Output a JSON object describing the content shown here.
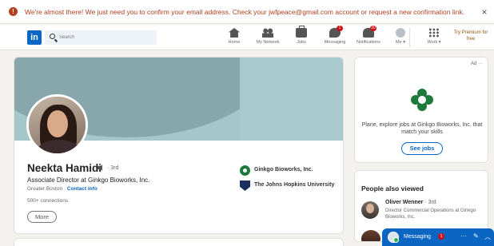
{
  "alert": {
    "message": "We're almost there! We just need you to confirm your email address. Check your jwfpeace@gmail.com account or request a new confirmation link.",
    "close": "×"
  },
  "nav": {
    "logo": "in",
    "search_placeholder": "Search",
    "items": [
      {
        "label": "Home",
        "icon": "home-icon"
      },
      {
        "label": "My Network",
        "icon": "network-icon"
      },
      {
        "label": "Jobs",
        "icon": "jobs-icon"
      },
      {
        "label": "Messaging",
        "icon": "messaging-icon",
        "badge": "1"
      },
      {
        "label": "Notifications",
        "icon": "bell-icon",
        "badge": "20"
      },
      {
        "label": "Me ▾",
        "icon": "avatar-icon"
      },
      {
        "label": "Work ▾",
        "icon": "grid-icon"
      }
    ],
    "premium": "Try Premium for free"
  },
  "profile": {
    "name": "Neekta Hamidi",
    "degree": "· 3rd",
    "headline": "Associate Director at Ginkgo Bioworks, Inc.",
    "location": "Greater Boston ·",
    "contact_info": "Contact info",
    "connections": "500+ connections",
    "more_button": "More",
    "orgs": [
      {
        "name": "Ginkgo Bioworks, Inc.",
        "icon": "ginkgo-logo"
      },
      {
        "name": "The Johns Hopkins University",
        "icon": "jhu-logo"
      }
    ]
  },
  "ad": {
    "label": "Ad ···",
    "text": "Plane, explore jobs at Ginkgo Bioworks, Inc. that match your skills",
    "button": "See jobs"
  },
  "people_also_viewed": {
    "title": "People also viewed",
    "people": [
      {
        "name": "Oliver Wenner",
        "degree": "· 3rd",
        "title": "Director Commercial Operations at Ginkgo Bioworks, Inc."
      }
    ]
  },
  "messaging": {
    "label": "Messaging",
    "badge": "1",
    "controls": [
      "···",
      "✎",
      "︿"
    ]
  },
  "colors": {
    "accent": "#0a66c2",
    "alert": "#b24020",
    "badge": "#cc1016",
    "brand_green": "#1e7a3c"
  }
}
